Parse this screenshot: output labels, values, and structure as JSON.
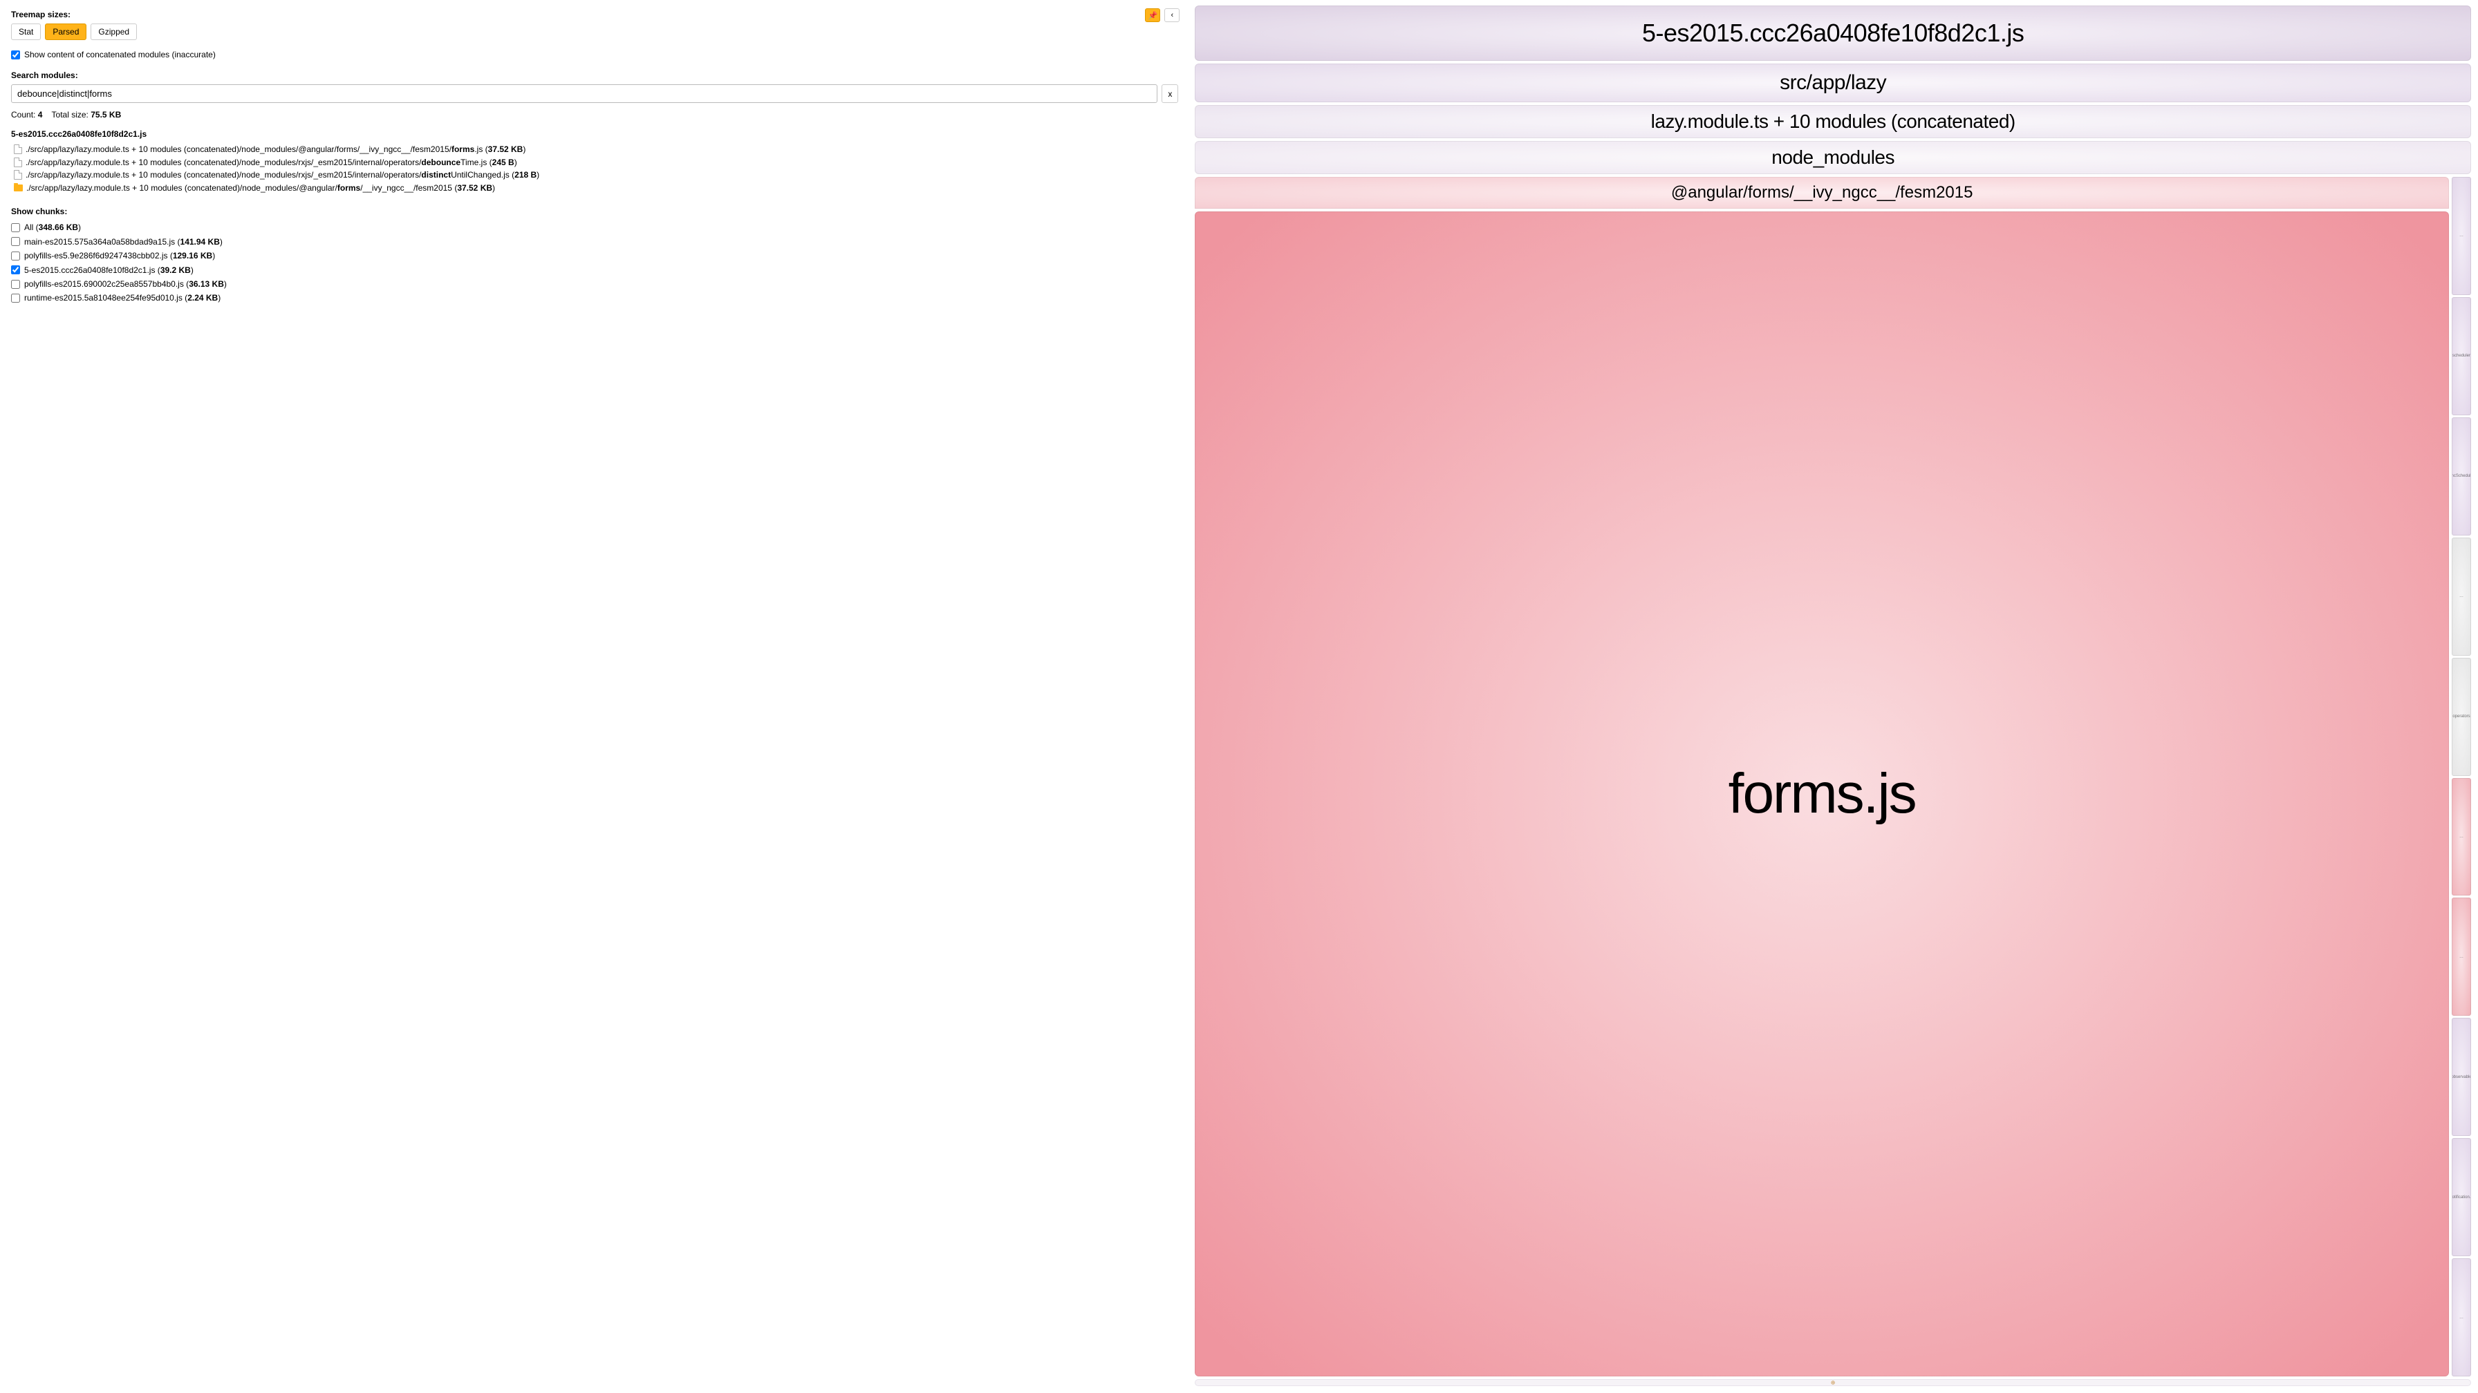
{
  "sidebar": {
    "treemap_sizes_label": "Treemap sizes:",
    "size_buttons": {
      "stat": "Stat",
      "parsed": "Parsed",
      "gzipped": "Gzipped"
    },
    "show_concat_label": "Show content of concatenated modules (inaccurate)",
    "search_label": "Search modules:",
    "search_value": "debounce|distinct|forms",
    "clear_label": "x",
    "count_label": "Count:",
    "count_value": "4",
    "total_size_label": "Total size:",
    "total_size_value": "75.5 KB",
    "result_group_title": "5-es2015.ccc26a0408fe10f8d2c1.js",
    "results": [
      {
        "icon": "file",
        "pre": "./src/app/lazy/lazy.module.ts + 10 modules (concatenated)/node_modules/@angular/forms/__ivy_ngcc__/fesm2015/",
        "bold": "forms",
        "post": ".js (",
        "size": "37.52 KB",
        "tail": ")"
      },
      {
        "icon": "file",
        "pre": "./src/app/lazy/lazy.module.ts + 10 modules (concatenated)/node_modules/rxjs/_esm2015/internal/operators/",
        "bold": "debounce",
        "post": "Time.js (",
        "size": "245 B",
        "tail": ")"
      },
      {
        "icon": "file",
        "pre": "./src/app/lazy/lazy.module.ts + 10 modules (concatenated)/node_modules/rxjs/_esm2015/internal/operators/",
        "bold": "distinct",
        "post": "UntilChanged.js (",
        "size": "218 B",
        "tail": ")"
      },
      {
        "icon": "folder",
        "pre": "./src/app/lazy/lazy.module.ts + 10 modules (concatenated)/node_modules/@angular/",
        "bold": "forms",
        "post": "/__ivy_ngcc__/fesm2015 (",
        "size": "37.52 KB",
        "tail": ")"
      }
    ],
    "show_chunks_label": "Show chunks:",
    "chunks": [
      {
        "checked": false,
        "name": "All",
        "size": "348.66 KB"
      },
      {
        "checked": false,
        "name": "main-es2015.575a364a0a58bdad9a15.js",
        "size": "141.94 KB"
      },
      {
        "checked": false,
        "name": "polyfills-es5.9e286f6d9247438cbb02.js",
        "size": "129.16 KB"
      },
      {
        "checked": true,
        "name": "5-es2015.ccc26a0408fe10f8d2c1.js",
        "size": "39.2 KB"
      },
      {
        "checked": false,
        "name": "polyfills-es2015.690002c25ea8557bb4b0.js",
        "size": "36.13 KB"
      },
      {
        "checked": false,
        "name": "runtime-es2015.5a81048ee254fe95d010.js",
        "size": "2.24 KB"
      }
    ]
  },
  "treemap": {
    "level1": "5-es2015.ccc26a0408fe10f8d2c1.js",
    "level2": "src/app/lazy",
    "level3": "lazy.module.ts + 10 modules (concatenated)",
    "level4": "node_modules",
    "pink_head": "@angular/forms/__ivy_ngcc__/fesm2015",
    "pink_body": "forms.js",
    "tiny": [
      "…",
      "scheduler",
      "AsyncScheduler.js",
      "…",
      "operators",
      "…",
      "…",
      "observable",
      "Notification.js",
      "…"
    ]
  },
  "icons": {
    "pin": "📌",
    "collapse": "‹"
  }
}
